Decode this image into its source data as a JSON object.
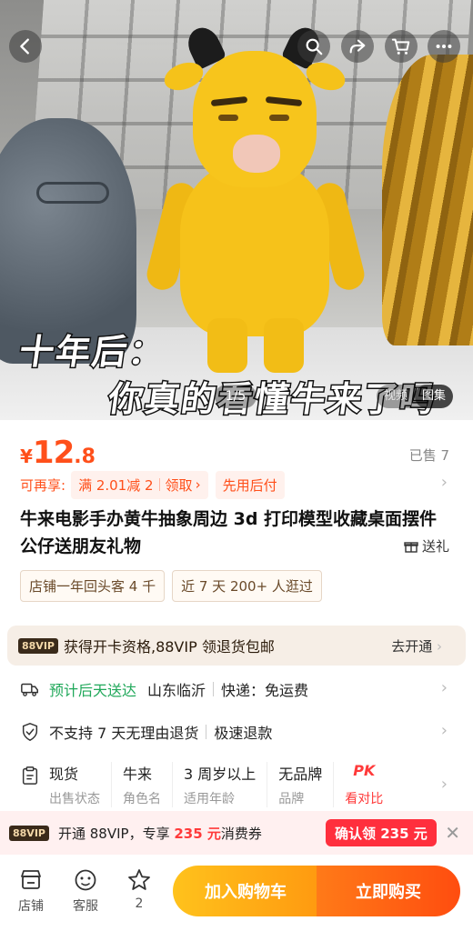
{
  "gallery": {
    "caption_line1": "十年后：",
    "caption_line2": "你真的看懂牛来了吗",
    "counter": "1/5",
    "tab_video": "视频",
    "tab_images": "图集"
  },
  "top_icons": [
    "back-icon",
    "search-icon",
    "share-icon",
    "cart-icon",
    "more-icon"
  ],
  "price": {
    "currency": "¥",
    "integer": "12",
    "decimal": ".8",
    "color": "#ff4f1a"
  },
  "sold": "已售 7",
  "promo": {
    "label": "可再享:",
    "coupon_text": "满 2.01减 2",
    "coupon_action": "领取",
    "paylater": "先用后付"
  },
  "product_title": "牛来电影手办黄牛抽象周边 3d 打印模型收藏桌面摆件公仔送朋友礼物",
  "gift_label": "送礼",
  "tags": [
    "店铺一年回头客 4 千",
    "近 7 天 200+ 人逛过"
  ],
  "vip_bar": {
    "badge": "88VIP",
    "text": "获得开卡资格,88VIP 领退货包邮",
    "action": "去开通"
  },
  "delivery": {
    "eta": "预计后天送达",
    "origin": "山东临沂",
    "shipping": "快递：免运费"
  },
  "returns": {
    "policy": "不支持 7 天无理由退货",
    "refund": "极速退款"
  },
  "attributes": [
    {
      "value": "现货",
      "key": "出售状态"
    },
    {
      "value": "牛来",
      "key": "角色名"
    },
    {
      "value": "3 周岁以上",
      "key": "适用年龄"
    },
    {
      "value": "无品牌",
      "key": "品牌"
    },
    {
      "value": "PK",
      "key": "看对比"
    }
  ],
  "vip_banner": {
    "badge": "88VIP",
    "text_prefix": "开通 88VIP，专享",
    "amount": "235 元",
    "text_suffix": "消费券",
    "button": "确认领 235 元"
  },
  "bottom_bar": {
    "shop_label": "店铺",
    "service_label": "客服",
    "fav_count": "2",
    "add_to_cart": "加入购物车",
    "buy_now": "立即购买"
  },
  "colors": {
    "accent": "#ff4f1a",
    "green": "#20a85a",
    "red": "#ff2f3d",
    "cart_start": "#ffc21c",
    "buy_end": "#ff4d0f"
  }
}
